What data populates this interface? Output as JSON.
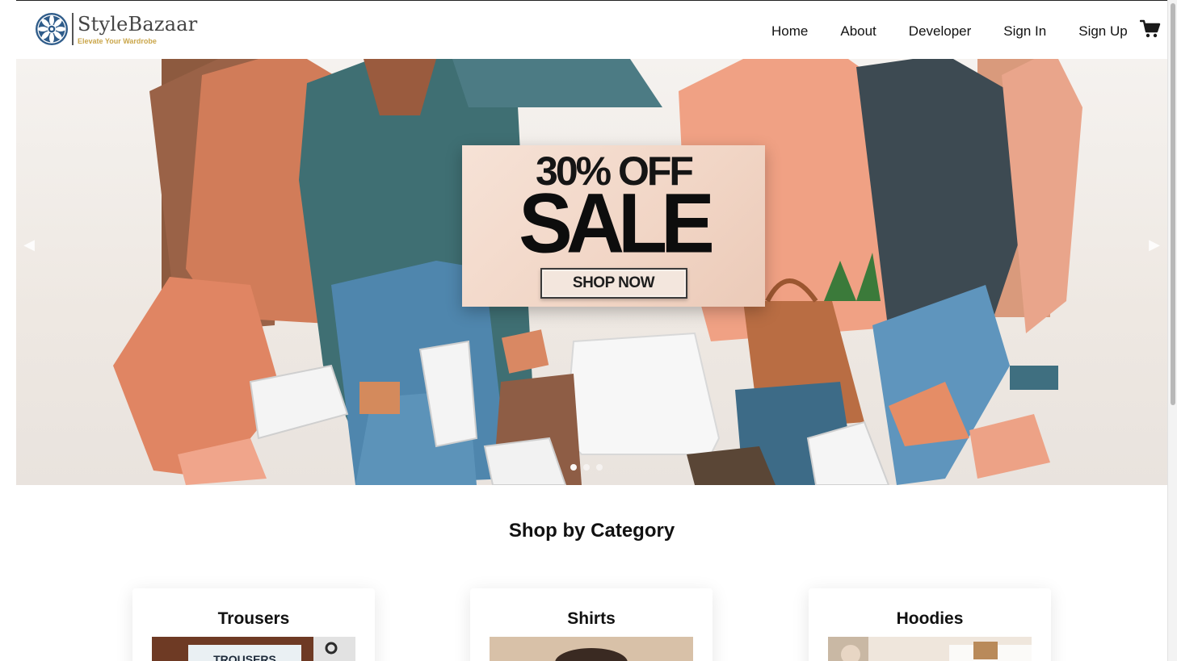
{
  "brand": {
    "name": "StyleBazaar",
    "tagline": "Elevate Your Wardrobe"
  },
  "nav": {
    "items": [
      "Home",
      "About",
      "Developer",
      "Sign In",
      "Sign Up"
    ],
    "cart_icon": "shopping-cart-icon"
  },
  "hero": {
    "promo_discount": "30% OFF",
    "promo_title": "SALE",
    "cta_label": "SHOP NOW",
    "prev_icon": "chevron-left-icon",
    "next_icon": "chevron-right-icon",
    "slide_count": 3,
    "active_slide": 1
  },
  "categories": {
    "heading": "Shop by Category",
    "items": [
      {
        "title": "Trousers",
        "image_text": "TROUSERS"
      },
      {
        "title": "Shirts"
      },
      {
        "title": "Hoodies"
      }
    ]
  },
  "colors": {
    "accent_gold": "#caa64a",
    "logo_blue": "#2f5c8a",
    "text": "#111111"
  }
}
